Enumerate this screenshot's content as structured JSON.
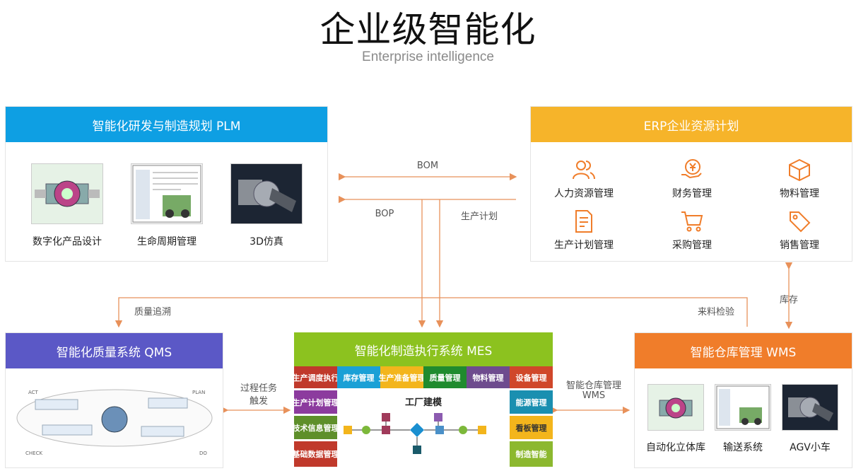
{
  "title": "企业级智能化",
  "subtitle": "Enterprise intelligence",
  "plm": {
    "title": "智能化研发与制造规划 PLM",
    "items": [
      "数字化产品设计",
      "生命周期管理",
      "3D仿真"
    ]
  },
  "erp": {
    "title": "ERP企业资源计划",
    "items": [
      {
        "label": "人力资源管理",
        "icon": "people-icon"
      },
      {
        "label": "财务管理",
        "icon": "finance-icon"
      },
      {
        "label": "物料管理",
        "icon": "box-icon"
      },
      {
        "label": "生产计划管理",
        "icon": "document-icon"
      },
      {
        "label": "采购管理",
        "icon": "cart-icon"
      },
      {
        "label": "销售管理",
        "icon": "tag-icon"
      }
    ]
  },
  "qms": {
    "title": "智能化质量系统 QMS",
    "diagram_labels": [
      "ACT",
      "PLAN",
      "CHECK",
      "DO"
    ]
  },
  "mes": {
    "title": "智能化制造执行系统 MES",
    "top": [
      "生产调度执行",
      "库存管理",
      "生产准备管理",
      "质量管理",
      "物料管理",
      "设备管理"
    ],
    "left": [
      "生产计划管理",
      "技术信息管理",
      "基础数据管理"
    ],
    "right": [
      "能源管理",
      "看板管理",
      "制造智能"
    ],
    "center": "工厂建模"
  },
  "wms": {
    "title": "智能仓库管理 WMS",
    "items": [
      "自动化立体库",
      "输送系统",
      "AGV小车"
    ]
  },
  "flows": {
    "bom": "BOM",
    "bop": "BOP",
    "plan": "生产计划",
    "quality": "质量追溯",
    "incoming": "来料检验",
    "inventory": "库存",
    "process_l1": "过程任务",
    "process_l2": "触发",
    "wms_l1": "智能仓库管理",
    "wms_l2": "WMS"
  },
  "colors": {
    "plm": "#0e9fe3",
    "erp": "#f6b42a",
    "qms": "#5b58c6",
    "mes": "#8cc21f",
    "wms": "#f07d2a",
    "arrow": "#e8915a"
  }
}
